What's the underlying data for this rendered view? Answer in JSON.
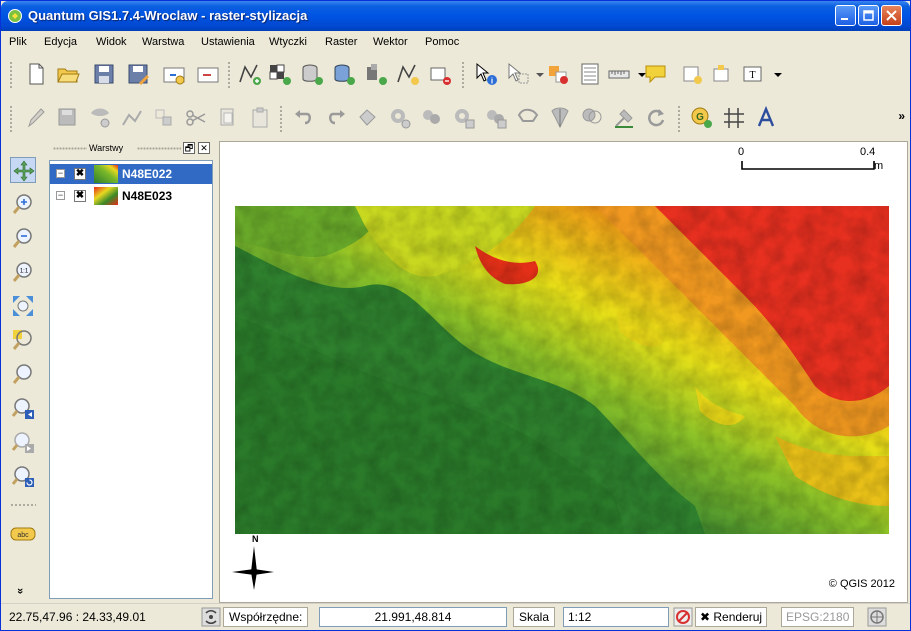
{
  "window": {
    "title": "Quantum GIS1.7.4-Wroclaw - raster-stylizacja"
  },
  "menu": [
    "Plik",
    "Edycja",
    "Widok",
    "Warstwa",
    "Ustawienia",
    "Wtyczki",
    "Raster",
    "Wektor",
    "Pomoc"
  ],
  "layers_panel": {
    "title": "Warstwy",
    "layers": [
      {
        "name": "N48E022",
        "visible": true,
        "selected": true
      },
      {
        "name": "N48E023",
        "visible": true,
        "selected": false
      }
    ]
  },
  "map": {
    "scale_bar": {
      "start": "0",
      "end": "0.4",
      "unit": "m"
    },
    "north_label": "N",
    "copyright": "© QGIS 2012",
    "colors": {
      "low": "#2e7d2e",
      "mid": "#e8e800",
      "high": "#e81818"
    }
  },
  "status": {
    "mouse_coords": "22.75,47.96 : 24.33,49.01",
    "coords_label": "Współrzędne:",
    "coords_value": "21.991,48.814",
    "scale_label": "Skala",
    "scale_value": "1:12",
    "render_label": "Renderuj",
    "render_checked": true,
    "epsg": "EPSG:2180"
  },
  "toolbar_more": "»",
  "left_expand": "»",
  "panel_float": "🗗",
  "panel_close": "✕"
}
